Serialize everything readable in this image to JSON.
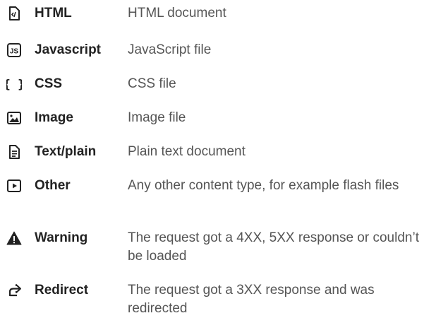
{
  "legend": {
    "items": [
      {
        "label": "HTML",
        "description": "HTML document",
        "icon": "html-file-icon"
      },
      {
        "label": "Javascript",
        "description": "JavaScript file",
        "icon": "js-file-icon"
      },
      {
        "label": "CSS",
        "description": "CSS file",
        "icon": "css-braces-icon"
      },
      {
        "label": "Image",
        "description": "Image file",
        "icon": "image-icon"
      },
      {
        "label": "Text/plain",
        "description": "Plain text document",
        "icon": "text-document-icon"
      },
      {
        "label": "Other",
        "description": "Any other content type, for example flash files",
        "icon": "play-icon"
      },
      {
        "label": "Warning",
        "description": "The request got a 4XX, 5XX response or couldn’t be loaded",
        "icon": "warning-icon"
      },
      {
        "label": "Redirect",
        "description": "The request got a 3XX response and was redirected",
        "icon": "redirect-icon"
      }
    ]
  }
}
